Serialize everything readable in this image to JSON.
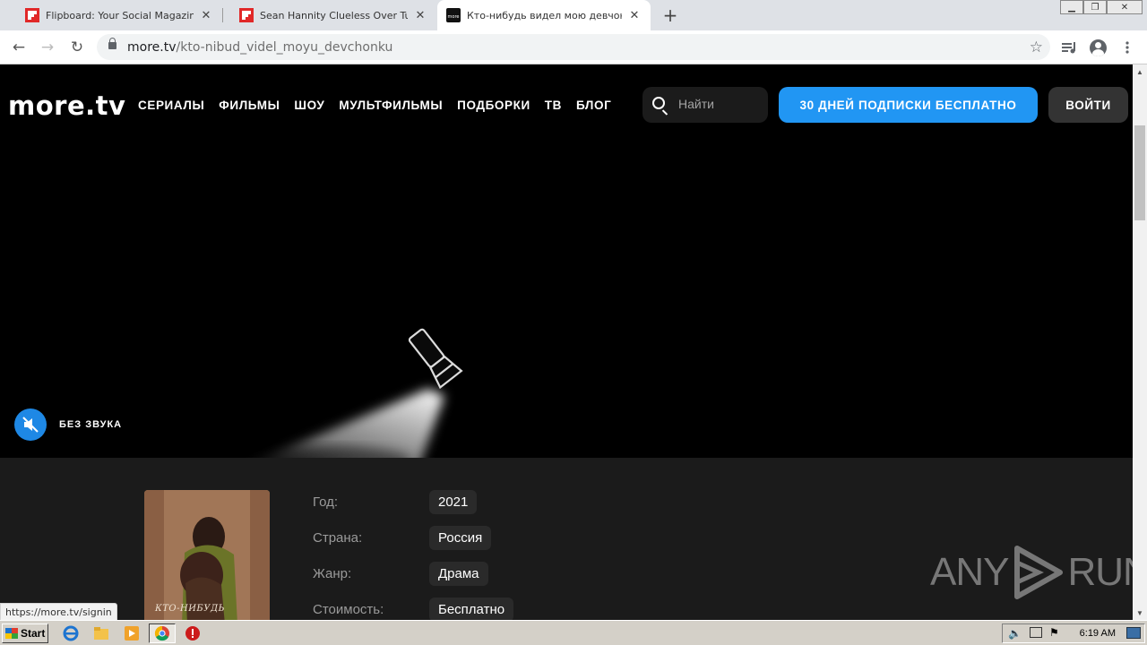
{
  "browser": {
    "tabs": [
      {
        "title": "Flipboard: Your Social Magazine",
        "active": false
      },
      {
        "title": "Sean Hannity Clueless Over Tucker C",
        "active": false
      },
      {
        "title": "Кто-нибудь видел мою девчонку?",
        "active": true
      }
    ],
    "new_tab_label": "+",
    "url_host": "more.tv",
    "url_path": "/kto-nibud_videl_moyu_devchonku",
    "status_url": "https://more.tv/signin"
  },
  "site": {
    "logo": "more.tv",
    "nav": [
      "СЕРИАЛЫ",
      "ФИЛЬМЫ",
      "ШОУ",
      "МУЛЬТФИЛЬМЫ",
      "ПОДБОРКИ",
      "ТВ",
      "БЛОГ"
    ],
    "search_placeholder": "Найти",
    "promo_button": "30 ДНЕЙ ПОДПИСКИ БЕСПЛАТНО",
    "login_button": "ВОЙТИ",
    "accent_color": "#2196f3"
  },
  "hero": {
    "mute_label": "БЕЗ ЗВУКА"
  },
  "movie": {
    "poster_caption": "КТО-НИБУДЬ",
    "details": [
      {
        "label": "Год:",
        "value": "2021"
      },
      {
        "label": "Страна:",
        "value": "Россия"
      },
      {
        "label": "Жанр:",
        "value": "Драма"
      },
      {
        "label": "Стоимость:",
        "value": "Бесплатно"
      }
    ]
  },
  "watermark": {
    "left": "ANY",
    "right": "RUN"
  },
  "taskbar": {
    "start_label": "Start",
    "clock": "6:19 AM"
  }
}
